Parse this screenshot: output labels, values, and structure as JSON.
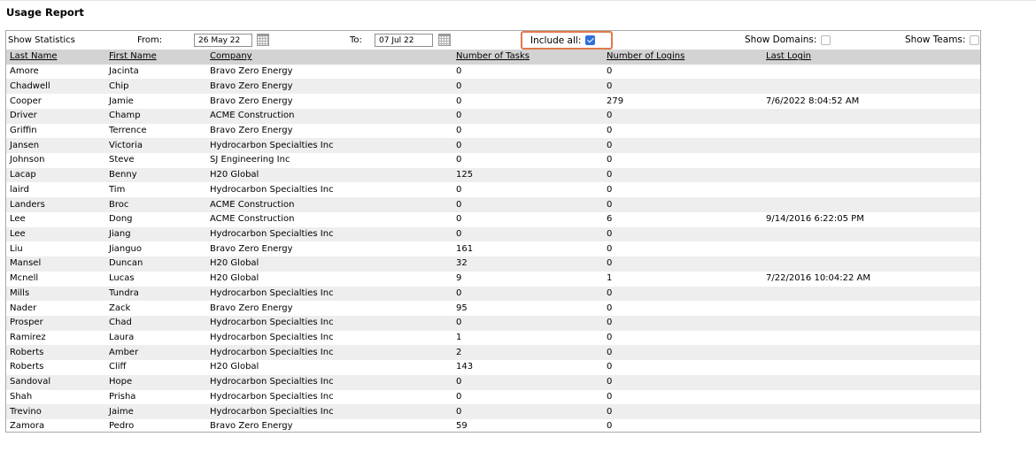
{
  "page": {
    "title": "Usage Report"
  },
  "toolbar": {
    "show_statistics_label": "Show Statistics",
    "from_label": "From:",
    "from_value": "26 May 22",
    "to_label": "To:",
    "to_value": "07 Jul 22",
    "include_all_label": "Include all:",
    "include_all_checked": true,
    "show_domains_label": "Show Domains:",
    "show_domains_checked": false,
    "show_teams_label": "Show Teams:",
    "show_teams_checked": false,
    "icons": [
      "calendar-icon",
      "calendar-icon"
    ],
    "highlight_color": "#e07a4f",
    "checkbox_color": "#2f6fde"
  },
  "table": {
    "columns": [
      "Last Name",
      "First Name",
      "Company",
      "Number of Tasks",
      "Number of Logins",
      "Last Login"
    ],
    "header_bg": "#d3d3d3",
    "alt_row_bg": "#eeeeee",
    "rows": [
      [
        "Amore",
        "Jacinta",
        "Bravo Zero Energy",
        "0",
        "0",
        ""
      ],
      [
        "Chadwell",
        "Chip",
        "Bravo Zero Energy",
        "0",
        "0",
        ""
      ],
      [
        "Cooper",
        "Jamie",
        "Bravo Zero Energy",
        "0",
        "279",
        "7/6/2022 8:04:52 AM"
      ],
      [
        "Driver",
        "Champ",
        "ACME Construction",
        "0",
        "0",
        ""
      ],
      [
        "Griffin",
        "Terrence",
        "Bravo Zero Energy",
        "0",
        "0",
        ""
      ],
      [
        "Jansen",
        "Victoria",
        "Hydrocarbon Specialties Inc",
        "0",
        "0",
        ""
      ],
      [
        "Johnson",
        "Steve",
        "SJ Engineering Inc",
        "0",
        "0",
        ""
      ],
      [
        "Lacap",
        "Benny",
        "H20 Global",
        "125",
        "0",
        ""
      ],
      [
        "laird",
        "Tim",
        "Hydrocarbon Specialties Inc",
        "0",
        "0",
        ""
      ],
      [
        "Landers",
        "Broc",
        "ACME Construction",
        "0",
        "0",
        ""
      ],
      [
        "Lee",
        "Dong",
        "ACME Construction",
        "0",
        "6",
        "9/14/2016 6:22:05 PM"
      ],
      [
        "Lee",
        "Jiang",
        "Hydrocarbon Specialties Inc",
        "0",
        "0",
        ""
      ],
      [
        "Liu",
        "Jianguo",
        "Bravo Zero Energy",
        "161",
        "0",
        ""
      ],
      [
        "Mansel",
        "Duncan",
        "H20 Global",
        "32",
        "0",
        ""
      ],
      [
        "Mcnell",
        "Lucas",
        "H20 Global",
        "9",
        "1",
        "7/22/2016 10:04:22 AM"
      ],
      [
        "Mills",
        "Tundra",
        "Hydrocarbon Specialties Inc",
        "0",
        "0",
        ""
      ],
      [
        "Nader",
        "Zack",
        "Bravo Zero Energy",
        "95",
        "0",
        ""
      ],
      [
        "Prosper",
        "Chad",
        "Hydrocarbon Specialties Inc",
        "0",
        "0",
        ""
      ],
      [
        "Ramirez",
        "Laura",
        "Hydrocarbon Specialties Inc",
        "1",
        "0",
        ""
      ],
      [
        "Roberts",
        "Amber",
        "Hydrocarbon Specialties Inc",
        "2",
        "0",
        ""
      ],
      [
        "Roberts",
        "Cliff",
        "H20 Global",
        "143",
        "0",
        ""
      ],
      [
        "Sandoval",
        "Hope",
        "Hydrocarbon Specialties Inc",
        "0",
        "0",
        ""
      ],
      [
        "Shah",
        "Prisha",
        "Hydrocarbon Specialties Inc",
        "0",
        "0",
        ""
      ],
      [
        "Trevino",
        "Jaime",
        "Hydrocarbon Specialties Inc",
        "0",
        "0",
        ""
      ],
      [
        "Zamora",
        "Pedro",
        "Bravo Zero Energy",
        "59",
        "0",
        ""
      ]
    ]
  }
}
